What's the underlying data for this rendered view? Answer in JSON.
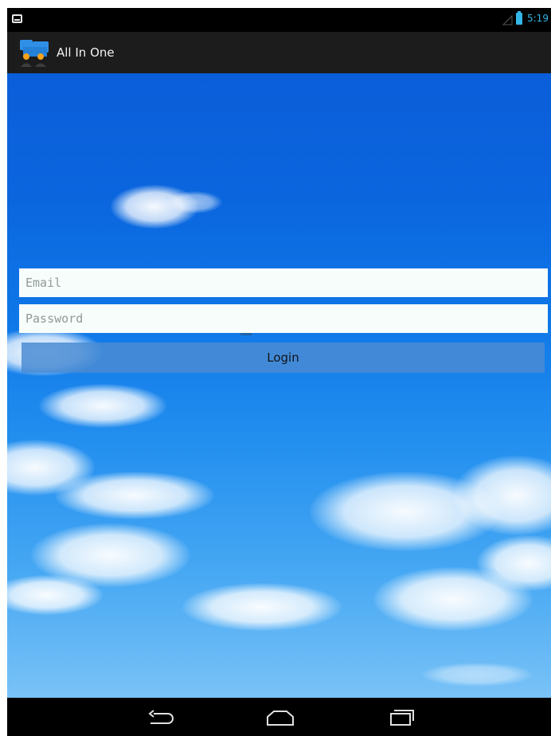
{
  "status_bar": {
    "time": "5:19",
    "accent_color": "#33b5e5"
  },
  "action_bar": {
    "title": "All In One",
    "icon": "app-logo-icon"
  },
  "login_form": {
    "email_placeholder": "Email",
    "password_placeholder": "Password",
    "login_label": "Login"
  },
  "nav_bar": {
    "icons": [
      "back-icon",
      "home-icon",
      "recent-apps-icon"
    ]
  }
}
